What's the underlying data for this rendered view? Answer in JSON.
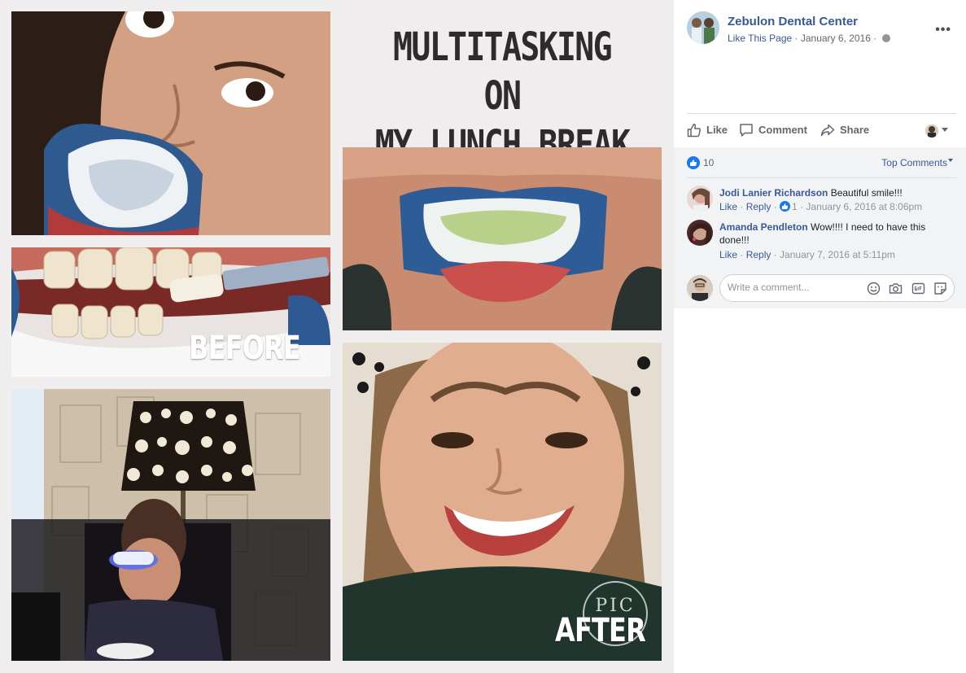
{
  "collage": {
    "headline_line1": "MULTITASKING ON",
    "headline_line2": "MY LUNCH BREAK",
    "before_label": "BEFORE",
    "after_label": "AFTER",
    "watermark": "PIC"
  },
  "post": {
    "page_name": "Zebulon Dental Center",
    "like_page": "Like This Page",
    "separator": "·",
    "date": "January 6, 2016",
    "privacy_icon": "globe-icon",
    "more_icon": "more-dots-icon"
  },
  "actions": {
    "like_label": "Like",
    "comment_label": "Comment",
    "share_label": "Share"
  },
  "reactions": {
    "count": "10",
    "top_comments_label": "Top Comments"
  },
  "comments": [
    {
      "author": "Jodi Lanier Richardson",
      "text": "Beautiful smile!!!",
      "like_label": "Like",
      "reply_label": "Reply",
      "like_count": "1",
      "timestamp": "January 6, 2016 at 8:06pm"
    },
    {
      "author": "Amanda Pendleton",
      "text": "Wow!!!! I need to have this done!!!",
      "like_label": "Like",
      "reply_label": "Reply",
      "timestamp": "January 7, 2016 at 5:11pm"
    }
  ],
  "composer": {
    "placeholder": "Write a comment...",
    "tools": [
      "emoji-icon",
      "camera-icon",
      "gif-icon",
      "sticker-icon"
    ]
  },
  "colors": {
    "link": "#385898",
    "brand_blue": "#1877f2",
    "comments_bg": "#f2f3f5"
  }
}
